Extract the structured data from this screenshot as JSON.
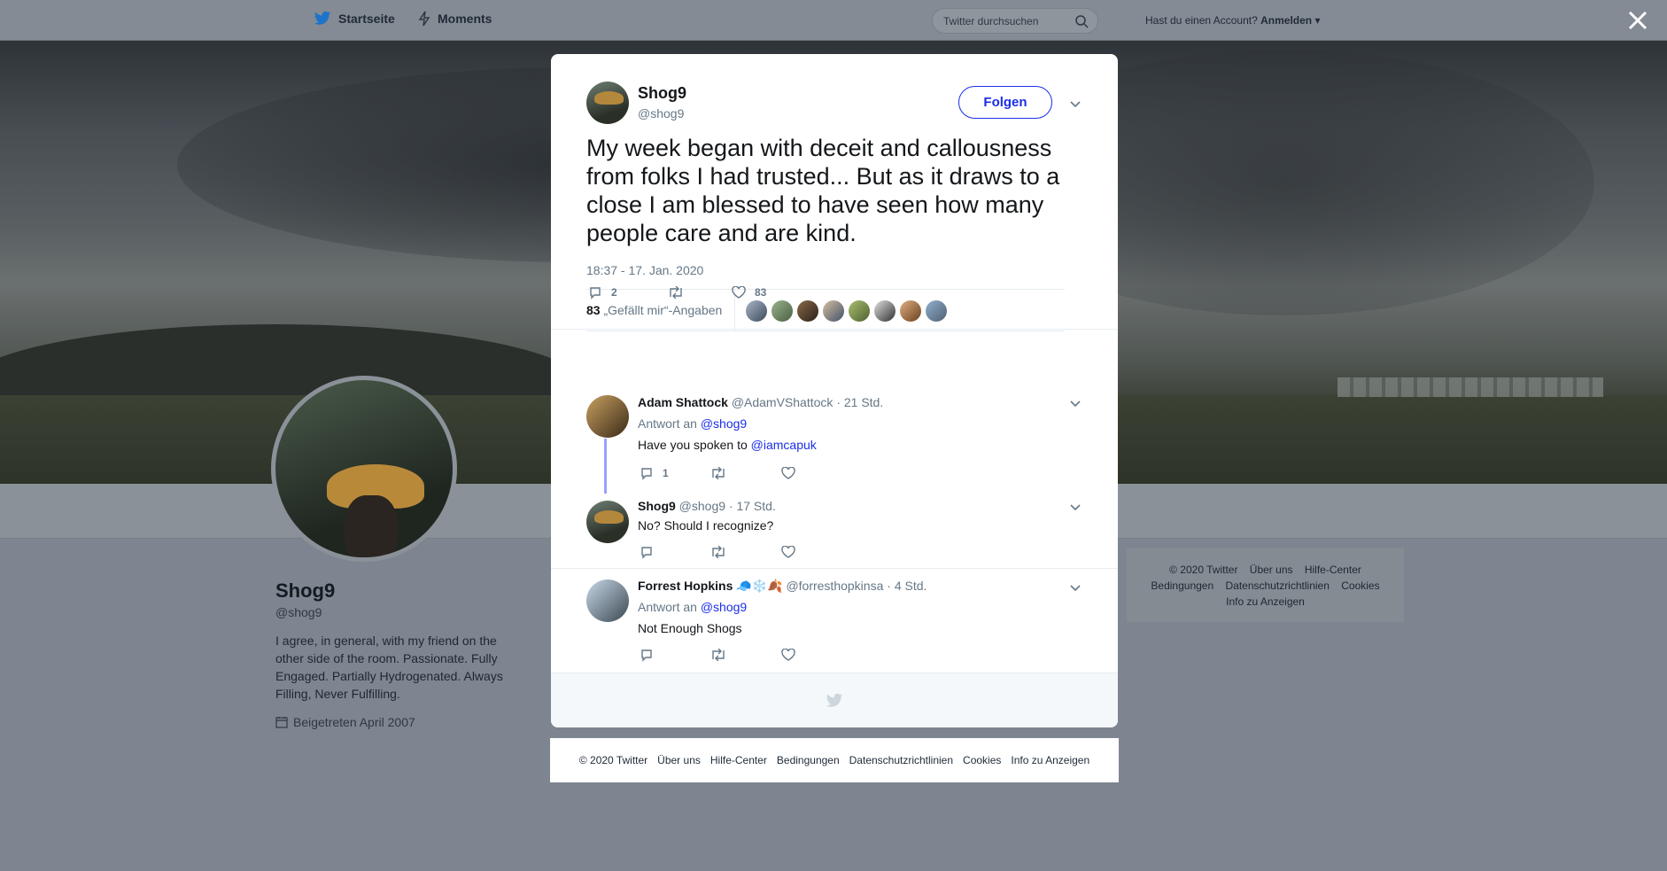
{
  "topbar": {
    "home_label": "Startseite",
    "moments_label": "Moments",
    "search_placeholder": "Twitter durchsuchen",
    "account_question": "Hast du einen Account?",
    "login_label": "Anmelden"
  },
  "profile": {
    "name": "Shog9",
    "handle": "@shog9",
    "bio": "I agree, in general, with my friend on the other side of the room. Passionate. Fully Engaged. Partially Hydrogenated. Always Filling, Never Fulfilling.",
    "joined": "Beigetreten April 2007"
  },
  "side_footer": {
    "line1": [
      "© 2020 Twitter",
      "Über uns",
      "Hilfe-Center"
    ],
    "line2": [
      "Bedingungen",
      "Datenschutzrichtlinien",
      "Cookies"
    ],
    "line3": [
      "Info zu Anzeigen"
    ]
  },
  "tweet": {
    "author_name": "Shog9",
    "author_handle": "@shog9",
    "follow_label": "Folgen",
    "text": "My week began with deceit and callousness from folks I had trusted... But as it draws to a close I am blessed to have seen how many people care and are kind.",
    "timestamp": "18:37 - 17. Jan. 2020",
    "likes_number": "83",
    "likes_label": "„Gefällt mir“-Angaben",
    "reply_count": "2",
    "like_count": "83"
  },
  "replies": [
    {
      "name": "Adam Shattock",
      "handle": "@AdamVShattock",
      "time": "· 21 Std.",
      "reply_to_prefix": "Antwort an",
      "reply_to_handle": "@shog9",
      "text_prefix": "Have you spoken to",
      "text_link": "@iamcapuk",
      "reply_count": "1"
    },
    {
      "name": "Shog9",
      "handle": "@shog9",
      "time": "· 17 Std.",
      "text": "No? Should I recognize?"
    },
    {
      "name": "Forrest Hopkins",
      "emoji": "🧢❄️🍂",
      "handle": "@forresthopkinsa",
      "time": "· 4 Std.",
      "reply_to_prefix": "Antwort an",
      "reply_to_handle": "@shog9",
      "text": "Not Enough Shogs"
    }
  ],
  "bottom_footer": [
    "© 2020 Twitter",
    "Über uns",
    "Hilfe-Center",
    "Bedingungen",
    "Datenschutzrichtlinien",
    "Cookies",
    "Info zu Anzeigen"
  ],
  "colors": {
    "link": "#1b2ee8",
    "muted": "#657786",
    "thread": "#9aa0ff"
  }
}
